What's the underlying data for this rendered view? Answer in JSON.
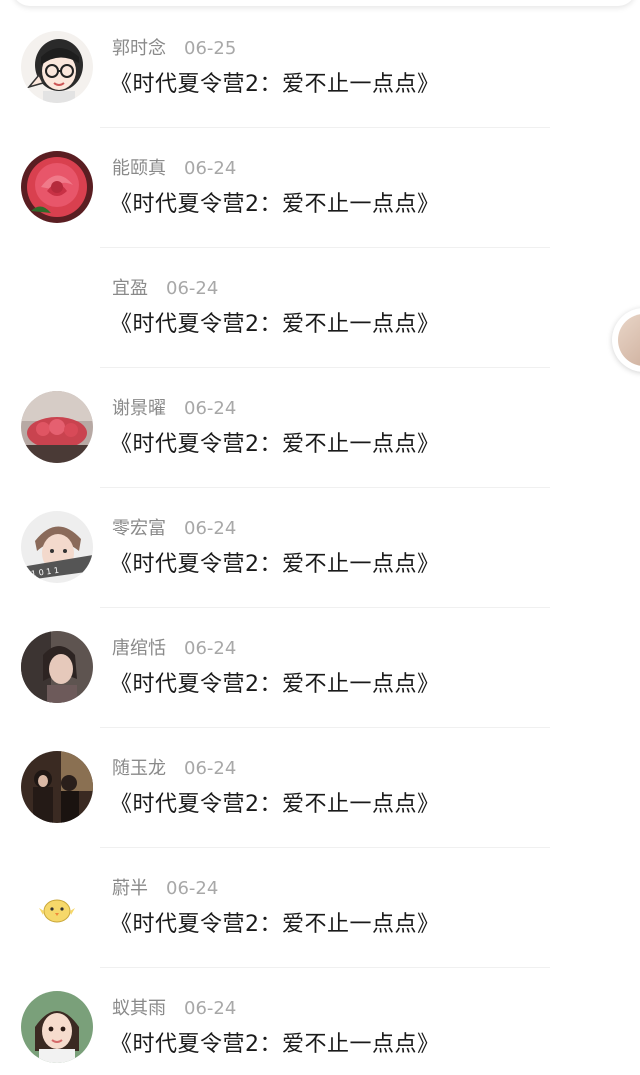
{
  "comments": [
    {
      "name": "郭时念",
      "date": "06-25",
      "title": "《时代夏令营2：爱不止一点点》",
      "avatar": "cartoon-girl-glasses-avatar"
    },
    {
      "name": "能颐真",
      "date": "06-24",
      "title": "《时代夏令营2：爱不止一点点》",
      "avatar": "pink-rose-avatar"
    },
    {
      "name": "宜盈",
      "date": "06-24",
      "title": "《时代夏令营2：爱不止一点点》",
      "avatar": "blank-avatar"
    },
    {
      "name": "谢景曜",
      "date": "06-24",
      "title": "《时代夏令营2：爱不止一点点》",
      "avatar": "red-roses-avatar"
    },
    {
      "name": "零宏富",
      "date": "06-24",
      "title": "《时代夏令营2：爱不止一点点》",
      "avatar": "boy-portrait-avatar"
    },
    {
      "name": "唐绾恬",
      "date": "06-24",
      "title": "《时代夏令营2：爱不止一点点》",
      "avatar": "dark-portrait-avatar"
    },
    {
      "name": "随玉龙",
      "date": "06-24",
      "title": "《时代夏令营2：爱不止一点点》",
      "avatar": "couple-photo-avatar"
    },
    {
      "name": "蔚半",
      "date": "06-24",
      "title": "《时代夏令营2：爱不止一点点》",
      "avatar": "yellow-chick-avatar"
    },
    {
      "name": "蚁其雨",
      "date": "06-24",
      "title": "《时代夏令营2：爱不止一点点》",
      "avatar": "little-girl-avatar"
    }
  ],
  "colors": {
    "name_text": "#8a8a8a",
    "date_text": "#a8a8a8",
    "title_text": "#1a1a1a",
    "divider": "#f0f0f0"
  }
}
